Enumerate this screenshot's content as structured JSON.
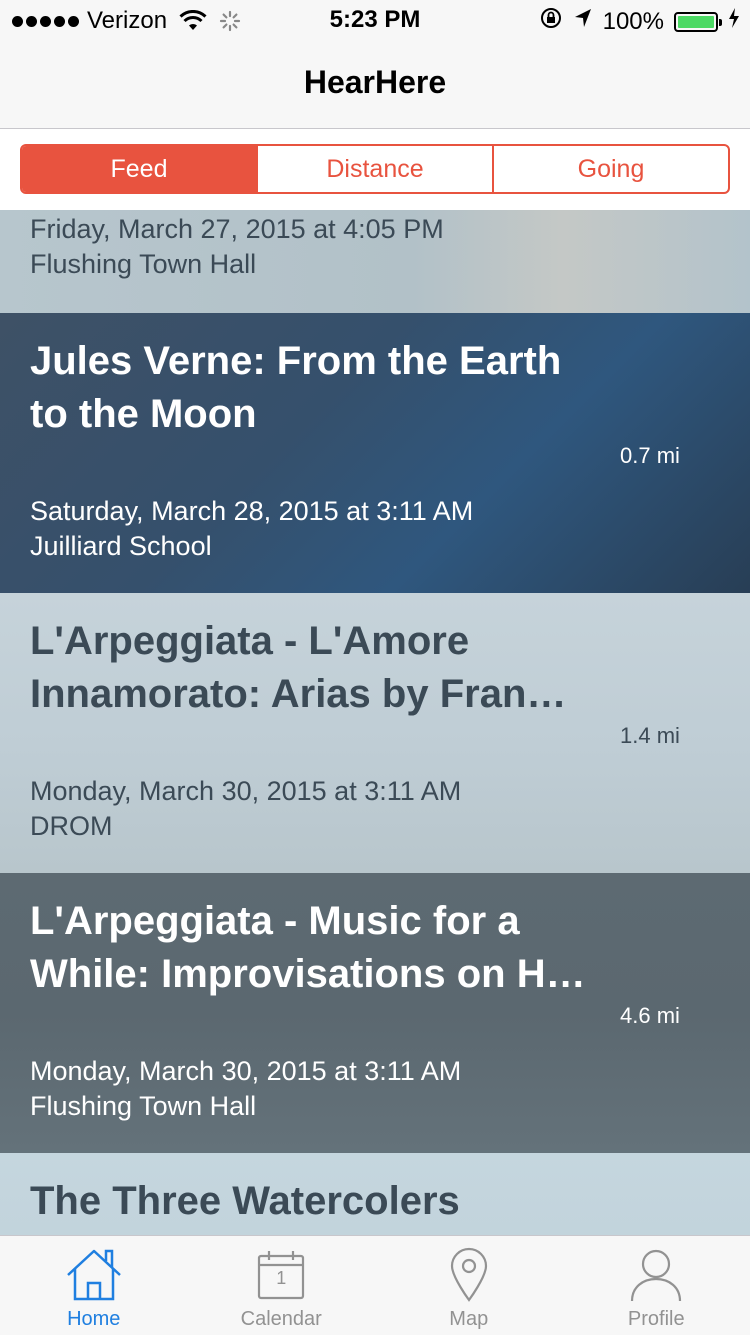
{
  "status_bar": {
    "carrier": "Verizon",
    "time": "5:23 PM",
    "battery": "100%",
    "battery_level": 1.0,
    "icons": [
      "signal-dots",
      "wifi-icon",
      "activity-spinner-icon",
      "rotation-lock-icon",
      "location-arrow-icon",
      "battery-icon",
      "charging-bolt-icon"
    ]
  },
  "nav": {
    "title": "HearHere"
  },
  "segments": [
    {
      "label": "Feed",
      "active": true
    },
    {
      "label": "Distance",
      "active": false
    },
    {
      "label": "Going",
      "active": false
    }
  ],
  "feed": [
    {
      "title": "",
      "date": "Friday, March 27, 2015 at 4:05 PM",
      "venue": "Flushing Town Hall",
      "distance": ""
    },
    {
      "title": "Jules Verne: From the Earth to the Moon",
      "date": "Saturday, March 28, 2015 at 3:11 AM",
      "venue": "Juilliard School",
      "distance": "0.7 mi"
    },
    {
      "title": "L'Arpeggiata - L'Amore Innamorato: Arias by Fran…",
      "date": "Monday, March 30, 2015 at 3:11 AM",
      "venue": "DROM",
      "distance": "1.4 mi"
    },
    {
      "title": "L'Arpeggiata - Music for a While: Improvisations on H…",
      "date": "Monday, March 30, 2015 at 3:11 AM",
      "venue": "Flushing Town Hall",
      "distance": "4.6 mi"
    },
    {
      "title": "The Three Watercolers",
      "date": "",
      "venue": "",
      "distance": ""
    }
  ],
  "tabs": [
    {
      "label": "Home",
      "icon": "home-icon",
      "active": true
    },
    {
      "label": "Calendar",
      "icon": "calendar-icon",
      "calendar_day": "1",
      "active": false
    },
    {
      "label": "Map",
      "icon": "map-pin-icon",
      "active": false
    },
    {
      "label": "Profile",
      "icon": "profile-icon",
      "active": false
    }
  ],
  "colors": {
    "accent": "#e8533f",
    "tab_active": "#1f7fe0",
    "tab_inactive": "#929292",
    "battery_fill": "#4cd964"
  }
}
